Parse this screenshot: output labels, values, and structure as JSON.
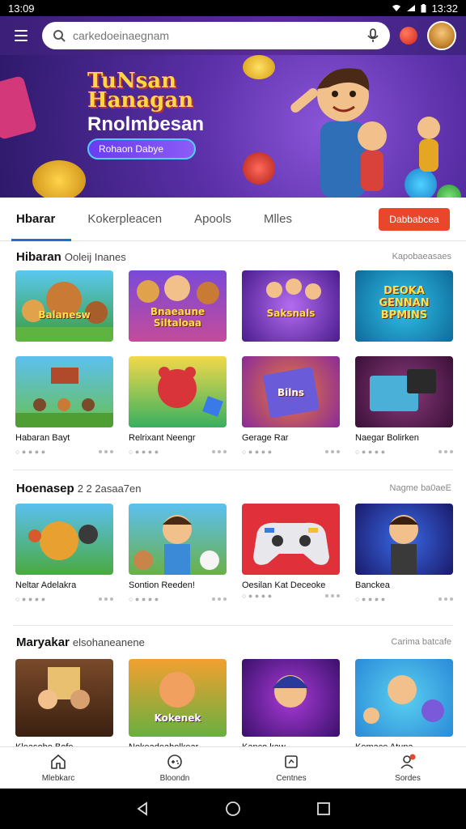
{
  "status": {
    "time": "13:09",
    "time_right": "13:32"
  },
  "search": {
    "value": "",
    "placeholder": "carkedoeinaegnam"
  },
  "hero": {
    "logo_line1": "TuNsan",
    "logo_line2": "Hanagan",
    "headline": "Rnolmbesan",
    "cta_label": "Rohaon Dabye"
  },
  "tabs": {
    "items": [
      "Hbarar",
      "Kokerpleacen",
      "Apools",
      "Mlles"
    ],
    "action_label": "Dabbabcea"
  },
  "sections": [
    {
      "title": "Hibaran",
      "subtitle": "Ooleij Inanes",
      "more": "Kapobaeasaes",
      "cards": [
        {
          "title": "",
          "thumb_text": "Balanesw"
        },
        {
          "title": "",
          "thumb_text": "Bnaeaune Siltaloaa"
        },
        {
          "title": "",
          "thumb_text": "Saksnals"
        },
        {
          "title": "",
          "thumb_text": "DEOKA GENNAN BPMINS"
        },
        {
          "title": "Habaran Bayt",
          "thumb_text": ""
        },
        {
          "title": "Relrixant Neengr",
          "thumb_text": ""
        },
        {
          "title": "Gerage Rar",
          "thumb_text": "Bilns"
        },
        {
          "title": "Naegar Bolirken",
          "thumb_text": ""
        }
      ]
    },
    {
      "title": "Hoenasep",
      "subtitle": "2 2 2asaa7en",
      "more": "Nagme ba0aeE",
      "cards": [
        {
          "title": "Neltar Adelakra",
          "thumb_text": ""
        },
        {
          "title": "Sontion Reeden!",
          "thumb_text": ""
        },
        {
          "title": "Oesilan Kat Deceoke",
          "thumb_text": ""
        },
        {
          "title": "Banckea",
          "thumb_text": ""
        }
      ]
    },
    {
      "title": "Maryakar",
      "subtitle": "elsohaneanene",
      "more": "Carima batcafe",
      "cards": [
        {
          "title": "Kleasoho Bofe",
          "thumb_text": ""
        },
        {
          "title": "Nokeadeaholkear",
          "thumb_text": "Kokenek"
        },
        {
          "title": "Kanco kaw",
          "thumb_text": ""
        },
        {
          "title": "Kemace Atuna",
          "thumb_text": ""
        }
      ]
    }
  ],
  "meta_text": "○ ● ● ● ●",
  "bottom_nav": [
    {
      "label": "Mlebkarc",
      "icon": "home-icon"
    },
    {
      "label": "Bloondn",
      "icon": "gamepad-icon"
    },
    {
      "label": "Centnes",
      "icon": "tablet-icon"
    },
    {
      "label": "Sordes",
      "icon": "profile-icon"
    }
  ]
}
